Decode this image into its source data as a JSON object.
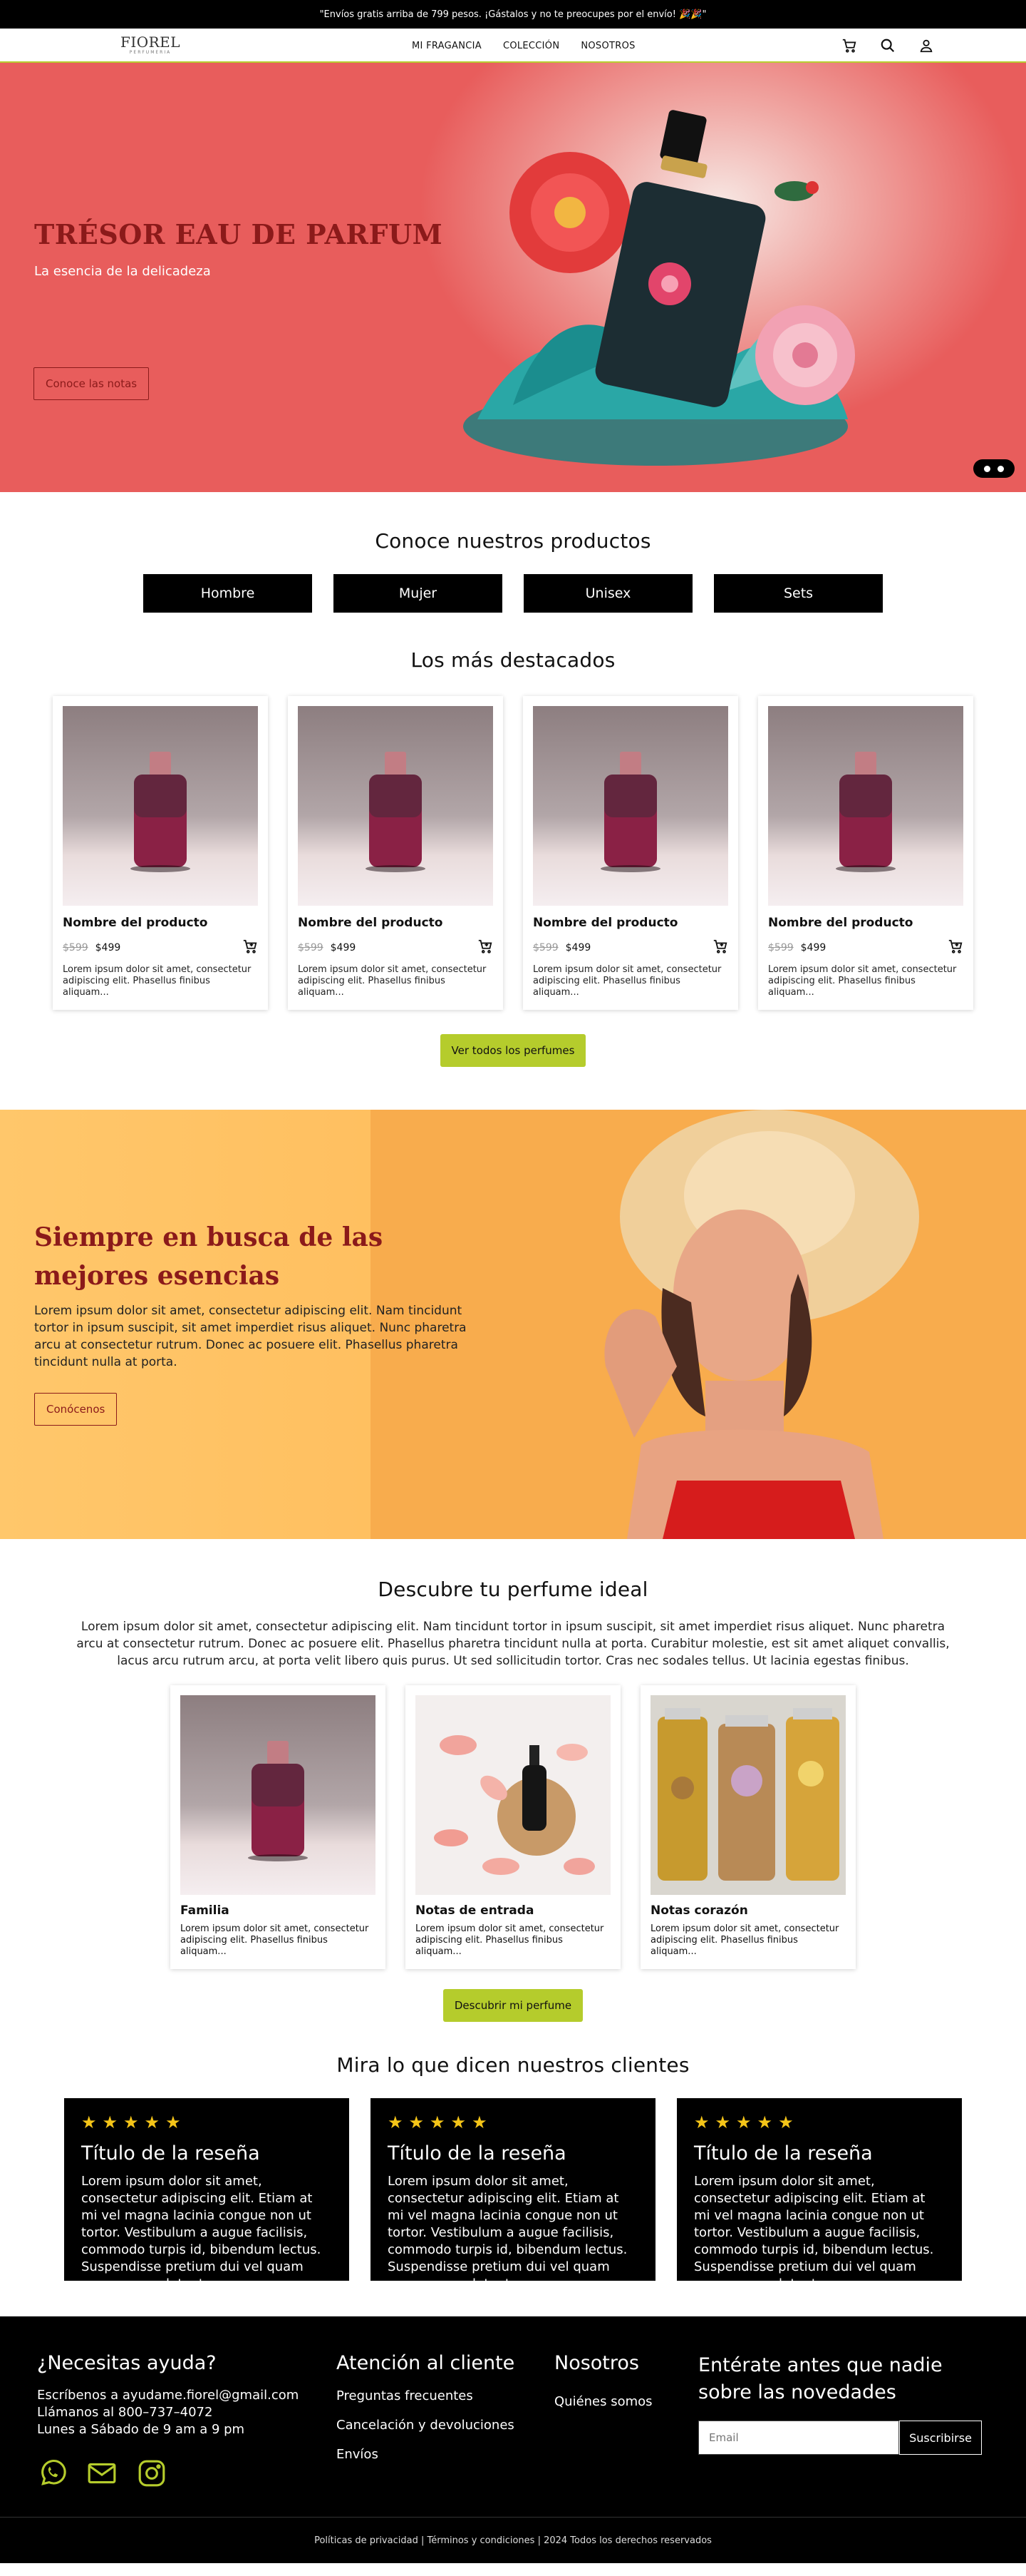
{
  "announcement": "\"Envíos gratis arriba de 799 pesos. ¡Gástalos y no te preocupes por el envío! 🎉🎉\"",
  "brand": {
    "name": "FIOREL",
    "sub": "PERFUMERIA"
  },
  "nav": [
    "MI FRAGANCIA",
    "COLECCIÓN",
    "NOSOTROS"
  ],
  "header_icons": [
    "cart-icon",
    "search-icon",
    "user-icon"
  ],
  "hero": {
    "title": "TRÉSOR EAU DE PARFUM",
    "tagline": "La esencia de la delicadeza",
    "cta": "Conoce las notas",
    "slides": 2
  },
  "categories": {
    "title": "Conoce nuestros productos",
    "items": [
      "Hombre",
      "Mujer",
      "Unisex",
      "Sets"
    ]
  },
  "featured": {
    "title": "Los más destacados",
    "products": [
      {
        "name": "Nombre del producto",
        "old_price": "$599",
        "price": "$499",
        "desc": "Lorem ipsum dolor sit amet, consectetur adipiscing elit. Phasellus finibus aliquam..."
      },
      {
        "name": "Nombre del producto",
        "old_price": "$599",
        "price": "$499",
        "desc": "Lorem ipsum dolor sit amet, consectetur adipiscing elit. Phasellus finibus aliquam..."
      },
      {
        "name": "Nombre del producto",
        "old_price": "$599",
        "price": "$499",
        "desc": "Lorem ipsum dolor sit amet, consectetur adipiscing elit. Phasellus finibus aliquam..."
      },
      {
        "name": "Nombre del producto",
        "old_price": "$599",
        "price": "$499",
        "desc": "Lorem ipsum dolor sit amet, consectetur adipiscing elit. Phasellus finibus aliquam..."
      }
    ],
    "cta": "Ver todos los perfumes"
  },
  "promo": {
    "title": "Siempre en busca de las mejores esencias",
    "text": "Lorem ipsum dolor sit amet, consectetur adipiscing elit. Nam tincidunt tortor in ipsum suscipit, sit amet imperdiet risus aliquet. Nunc pharetra arcu at consectetur rutrum. Donec ac posuere elit. Phasellus pharetra tincidunt nulla at porta.",
    "cta": "Conócenos"
  },
  "discover": {
    "title": "Descubre tu perfume ideal",
    "text": "Lorem ipsum dolor sit amet, consectetur adipiscing elit. Nam tincidunt tortor in ipsum suscipit, sit amet imperdiet risus aliquet. Nunc pharetra arcu at consectetur rutrum. Donec ac posuere elit. Phasellus pharetra tincidunt nulla at porta. Curabitur molestie, est sit amet aliquet convallis, lacus arcu rutrum arcu, at porta velit libero quis purus. Ut sed sollicitudin tortor. Cras nec sodales tellus. Ut lacinia egestas finibus.",
    "cards": [
      {
        "title": "Familia",
        "desc": "Lorem ipsum dolor sit amet, consectetur adipiscing elit. Phasellus finibus aliquam..."
      },
      {
        "title": "Notas de entrada",
        "desc": "Lorem ipsum dolor sit amet, consectetur adipiscing elit. Phasellus finibus aliquam..."
      },
      {
        "title": "Notas corazón",
        "desc": "Lorem ipsum dolor sit amet, consectetur adipiscing elit. Phasellus finibus aliquam..."
      }
    ],
    "cta": "Descubrir mi perfume"
  },
  "reviews": {
    "title": "Mira lo que dicen nuestros clientes",
    "stars": "★★★★★",
    "items": [
      {
        "title": "Título de la reseña",
        "text": "Lorem ipsum dolor sit amet, consectetur adipiscing elit. Etiam at mi vel magna lacinia congue non ut tortor. Vestibulum a augue facilisis, commodo turpis id, bibendum lectus. Suspendisse pretium dui vel quam accumsan volutpat."
      },
      {
        "title": "Título de la reseña",
        "text": "Lorem ipsum dolor sit amet, consectetur adipiscing elit. Etiam at mi vel magna lacinia congue non ut tortor. Vestibulum a augue facilisis, commodo turpis id, bibendum lectus. Suspendisse pretium dui vel quam accumsan volutpat."
      },
      {
        "title": "Título de la reseña",
        "text": "Lorem ipsum dolor sit amet, consectetur adipiscing elit. Etiam at mi vel magna lacinia congue non ut tortor. Vestibulum a augue facilisis, commodo turpis id, bibendum lectus. Suspendisse pretium dui vel quam accumsan volutpat."
      }
    ]
  },
  "footer": {
    "help_title": "¿Necesitas ayuda?",
    "help_lines": [
      "Escríbenos a ayudame.fiorel@gmail.com",
      "Llámanos al 800–737–4072",
      "Lunes a Sábado de 9 am a 9 pm"
    ],
    "service_title": "Atención al cliente",
    "service_links": [
      "Preguntas frecuentes",
      "Cancelación y devoluciones",
      "Envíos"
    ],
    "about_title": "Nosotros",
    "about_links": [
      "Quiénes somos"
    ],
    "news_title": "Entérate antes que nadie sobre las novedades",
    "email_placeholder": "Email",
    "subscribe": "Suscribirse",
    "social": [
      "whatsapp-icon",
      "mail-icon",
      "instagram-icon"
    ],
    "legal": "Políticas de privacidad | Términos y condiciones | 2024 Todos los derechos reservados",
    "green": "#b5cc2c"
  }
}
